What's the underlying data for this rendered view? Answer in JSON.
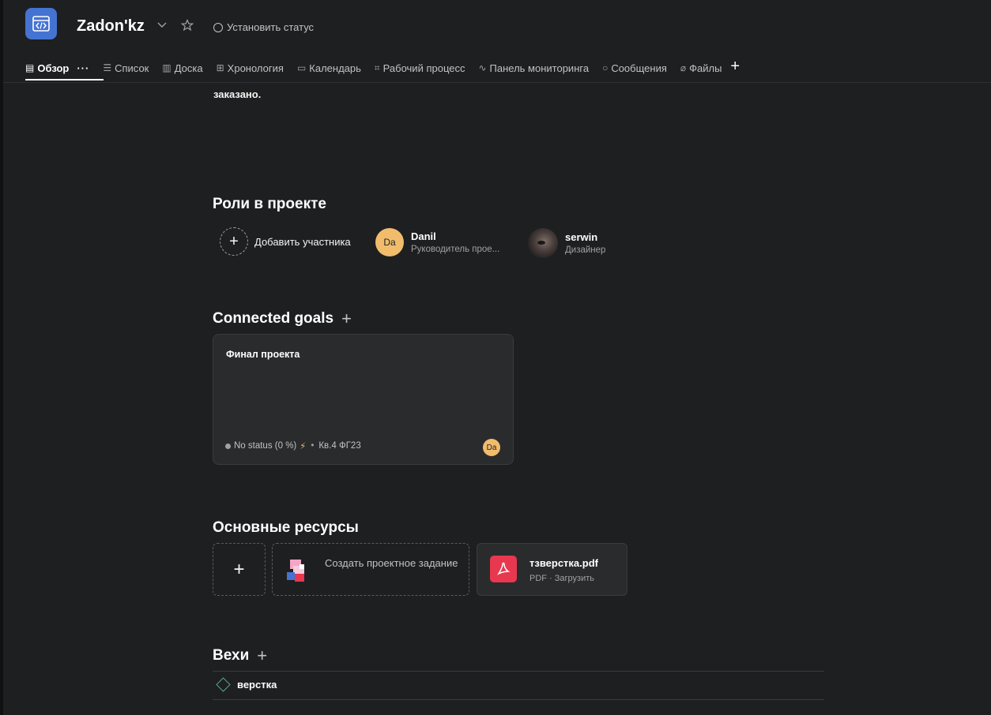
{
  "header": {
    "title": "Zadon'kz",
    "status_label": "Установить статус",
    "tabs": [
      {
        "label": "Обзор",
        "icon": "clipboard-icon"
      },
      {
        "label": "Список",
        "icon": "list-icon"
      },
      {
        "label": "Доска",
        "icon": "board-icon"
      },
      {
        "label": "Хронология",
        "icon": "timeline-icon"
      },
      {
        "label": "Календарь",
        "icon": "calendar-icon"
      },
      {
        "label": "Рабочий процесс",
        "icon": "workflow-icon"
      },
      {
        "label": "Панель мониторинга",
        "icon": "dashboard-icon"
      },
      {
        "label": "Сообщения",
        "icon": "message-icon"
      },
      {
        "label": "Файлы",
        "icon": "paperclip-icon"
      }
    ],
    "more_label": "···"
  },
  "overview": {
    "cut_text": "заказано."
  },
  "roles": {
    "heading": "Роли в проекте",
    "add_member_label": "Добавить участника",
    "members": [
      {
        "initials": "Da",
        "name": "Danil",
        "role": "Руководитель прое..."
      },
      {
        "initials": "",
        "name": "serwin",
        "role": "Дизайнер"
      }
    ]
  },
  "goals": {
    "heading": "Connected goals",
    "card": {
      "title": "Финал проекта",
      "status": "No status (0 %)",
      "period": "Кв.4 ФГ23",
      "owner_initials": "Da"
    }
  },
  "resources": {
    "heading": "Основные ресурсы",
    "create_label": "Создать проектное задание",
    "file_name": "тзверстка.pdf",
    "file_sub": "PDF · Загрузить"
  },
  "milestones": {
    "heading": "Вехи",
    "items": [
      {
        "label": "верстка"
      }
    ]
  },
  "colors": {
    "accent": "#4573d2",
    "avatar": "#f1bd6c",
    "pdf": "#e8384f",
    "milestone": "#5da283"
  }
}
